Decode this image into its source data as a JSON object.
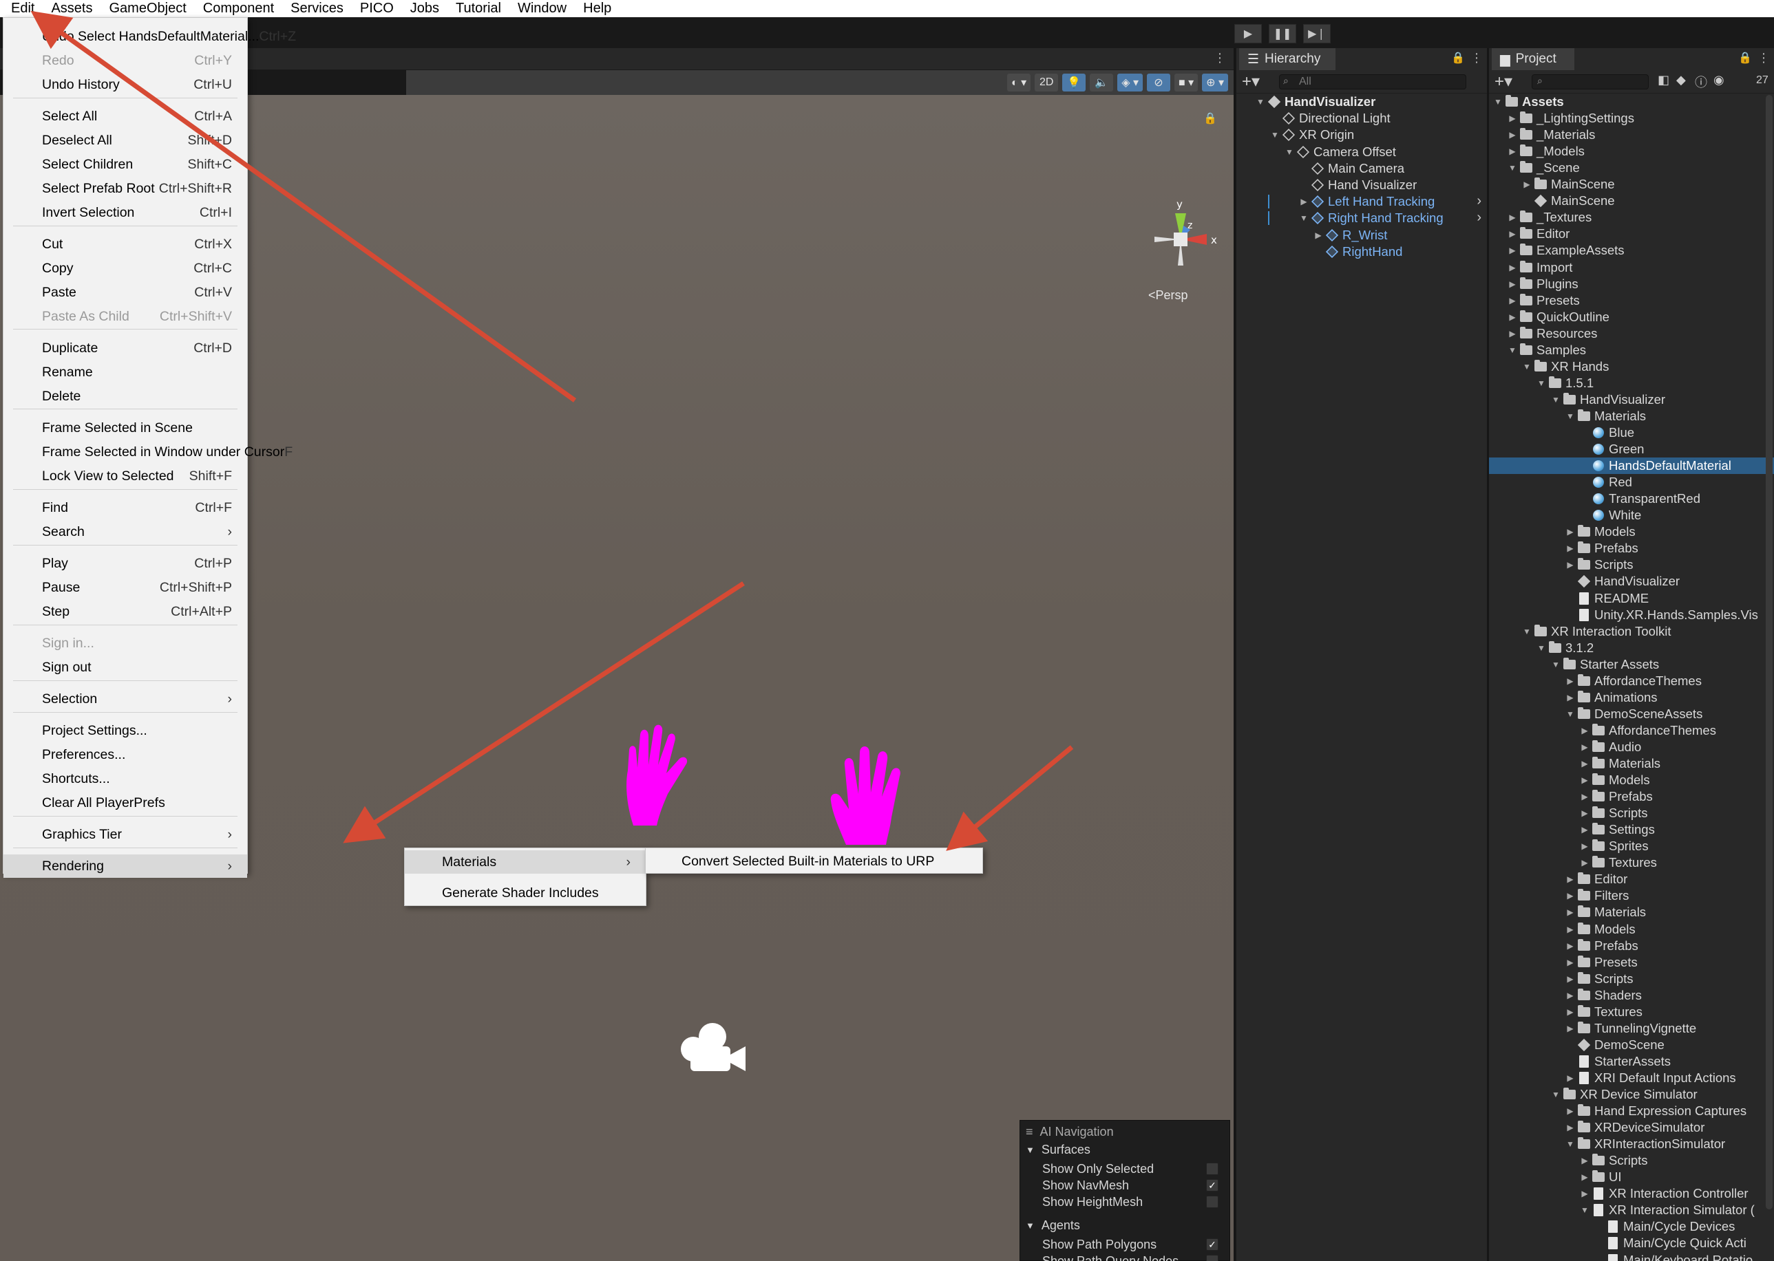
{
  "menubar": [
    "Edit",
    "Assets",
    "GameObject",
    "Component",
    "Services",
    "PICO",
    "Jobs",
    "Tutorial",
    "Window",
    "Help"
  ],
  "edit_menu": {
    "items": [
      {
        "label": "Undo Select HandsDefaultMaterial...",
        "shortcut": "Ctrl+Z"
      },
      {
        "label": "Redo",
        "shortcut": "Ctrl+Y",
        "disabled": true
      },
      {
        "label": "Undo History",
        "shortcut": "Ctrl+U"
      },
      {
        "label": "Select All",
        "shortcut": "Ctrl+A"
      },
      {
        "label": "Deselect All",
        "shortcut": "Shift+D"
      },
      {
        "label": "Select Children",
        "shortcut": "Shift+C"
      },
      {
        "label": "Select Prefab Root",
        "shortcut": "Ctrl+Shift+R"
      },
      {
        "label": "Invert Selection",
        "shortcut": "Ctrl+I"
      },
      {
        "label": "Cut",
        "shortcut": "Ctrl+X"
      },
      {
        "label": "Copy",
        "shortcut": "Ctrl+C"
      },
      {
        "label": "Paste",
        "shortcut": "Ctrl+V"
      },
      {
        "label": "Paste As Child",
        "shortcut": "Ctrl+Shift+V",
        "disabled": true
      },
      {
        "label": "Duplicate",
        "shortcut": "Ctrl+D"
      },
      {
        "label": "Rename",
        "shortcut": ""
      },
      {
        "label": "Delete",
        "shortcut": ""
      },
      {
        "label": "Frame Selected in Scene",
        "shortcut": ""
      },
      {
        "label": "Frame Selected in Window under Cursor",
        "shortcut": "F"
      },
      {
        "label": "Lock View to Selected",
        "shortcut": "Shift+F"
      },
      {
        "label": "Find",
        "shortcut": "Ctrl+F"
      },
      {
        "label": "Search",
        "shortcut": "›"
      },
      {
        "label": "Play",
        "shortcut": "Ctrl+P"
      },
      {
        "label": "Pause",
        "shortcut": "Ctrl+Shift+P"
      },
      {
        "label": "Step",
        "shortcut": "Ctrl+Alt+P"
      },
      {
        "label": "Sign in...",
        "shortcut": "",
        "disabled": true
      },
      {
        "label": "Sign out",
        "shortcut": ""
      },
      {
        "label": "Selection",
        "shortcut": "›"
      },
      {
        "label": "Project Settings...",
        "shortcut": ""
      },
      {
        "label": "Preferences...",
        "shortcut": ""
      },
      {
        "label": "Shortcuts...",
        "shortcut": ""
      },
      {
        "label": "Clear All PlayerPrefs",
        "shortcut": ""
      },
      {
        "label": "Graphics Tier",
        "shortcut": "›"
      },
      {
        "label": "Rendering",
        "shortcut": "›",
        "highlighted": true
      }
    ]
  },
  "submenu_rendering": [
    {
      "label": "Materials",
      "shortcut": "›",
      "highlighted": true
    },
    {
      "label": "Generate Shader Includes",
      "shortcut": ""
    }
  ],
  "submenu_materials": [
    {
      "label": "Convert Selected Built-in Materials to URP"
    }
  ],
  "scene": {
    "toolbar_2d": "2D",
    "persp_label": "<Persp",
    "gizmo_axes": {
      "y": "y",
      "z": "z",
      "x": "x"
    }
  },
  "hierarchy": {
    "tab": "Hierarchy",
    "search_placeholder": "All",
    "rows": [
      {
        "label": "HandVisualizer",
        "depth": 0,
        "bold": true,
        "icon": "unity-scene-icon",
        "arrow": "▼"
      },
      {
        "label": "Directional Light",
        "depth": 1,
        "icon": "gameobject-icon",
        "arrow": ""
      },
      {
        "label": "XR Origin",
        "depth": 1,
        "icon": "gameobject-icon",
        "arrow": "▼"
      },
      {
        "label": "Camera Offset",
        "depth": 2,
        "icon": "gameobject-icon",
        "arrow": "▼"
      },
      {
        "label": "Main Camera",
        "depth": 3,
        "icon": "gameobject-icon",
        "arrow": ""
      },
      {
        "label": "Hand Visualizer",
        "depth": 3,
        "icon": "gameobject-icon",
        "arrow": ""
      },
      {
        "label": "Left Hand Tracking",
        "depth": 3,
        "icon": "prefab-icon",
        "arrow": "▶",
        "prefab": true
      },
      {
        "label": "Right Hand Tracking",
        "depth": 3,
        "icon": "prefab-icon",
        "arrow": "▼",
        "prefab": true
      },
      {
        "label": "R_Wrist",
        "depth": 4,
        "icon": "gameobject-icon",
        "arrow": "▶",
        "prefab": true
      },
      {
        "label": "RightHand",
        "depth": 4,
        "icon": "gameobject-icon",
        "arrow": "",
        "prefab": true
      }
    ]
  },
  "project": {
    "tab": "Project",
    "count": "27",
    "rows": [
      {
        "label": "Assets",
        "depth": 0,
        "arrow": "▼",
        "icon": "folder",
        "bold": true
      },
      {
        "label": "_LightingSettings",
        "depth": 1,
        "arrow": "▶",
        "icon": "folder"
      },
      {
        "label": "_Materials",
        "depth": 1,
        "arrow": "▶",
        "icon": "folder"
      },
      {
        "label": "_Models",
        "depth": 1,
        "arrow": "▶",
        "icon": "folder"
      },
      {
        "label": "_Scene",
        "depth": 1,
        "arrow": "▼",
        "icon": "folder"
      },
      {
        "label": "MainScene",
        "depth": 2,
        "arrow": "▶",
        "icon": "folder"
      },
      {
        "label": "MainScene",
        "depth": 2,
        "arrow": "",
        "icon": "scene"
      },
      {
        "label": "_Textures",
        "depth": 1,
        "arrow": "▶",
        "icon": "folder"
      },
      {
        "label": "Editor",
        "depth": 1,
        "arrow": "▶",
        "icon": "folder"
      },
      {
        "label": "ExampleAssets",
        "depth": 1,
        "arrow": "▶",
        "icon": "folder"
      },
      {
        "label": "Import",
        "depth": 1,
        "arrow": "▶",
        "icon": "folder"
      },
      {
        "label": "Plugins",
        "depth": 1,
        "arrow": "▶",
        "icon": "folder"
      },
      {
        "label": "Presets",
        "depth": 1,
        "arrow": "▶",
        "icon": "folder"
      },
      {
        "label": "QuickOutline",
        "depth": 1,
        "arrow": "▶",
        "icon": "folder"
      },
      {
        "label": "Resources",
        "depth": 1,
        "arrow": "▶",
        "icon": "folder"
      },
      {
        "label": "Samples",
        "depth": 1,
        "arrow": "▼",
        "icon": "folder"
      },
      {
        "label": "XR Hands",
        "depth": 2,
        "arrow": "▼",
        "icon": "folder"
      },
      {
        "label": "1.5.1",
        "depth": 3,
        "arrow": "▼",
        "icon": "folder"
      },
      {
        "label": "HandVisualizer",
        "depth": 4,
        "arrow": "▼",
        "icon": "folder"
      },
      {
        "label": "Materials",
        "depth": 5,
        "arrow": "▼",
        "icon": "folder"
      },
      {
        "label": "Blue",
        "depth": 6,
        "arrow": "",
        "icon": "material"
      },
      {
        "label": "Green",
        "depth": 6,
        "arrow": "",
        "icon": "material"
      },
      {
        "label": "HandsDefaultMaterial",
        "depth": 6,
        "arrow": "",
        "icon": "material",
        "selected": true
      },
      {
        "label": "Red",
        "depth": 6,
        "arrow": "",
        "icon": "material"
      },
      {
        "label": "TransparentRed",
        "depth": 6,
        "arrow": "",
        "icon": "material"
      },
      {
        "label": "White",
        "depth": 6,
        "arrow": "",
        "icon": "material"
      },
      {
        "label": "Models",
        "depth": 5,
        "arrow": "▶",
        "icon": "folder"
      },
      {
        "label": "Prefabs",
        "depth": 5,
        "arrow": "▶",
        "icon": "folder"
      },
      {
        "label": "Scripts",
        "depth": 5,
        "arrow": "▶",
        "icon": "folder"
      },
      {
        "label": "HandVisualizer",
        "depth": 5,
        "arrow": "",
        "icon": "scene"
      },
      {
        "label": "README",
        "depth": 5,
        "arrow": "",
        "icon": "doc"
      },
      {
        "label": "Unity.XR.Hands.Samples.Vis",
        "depth": 5,
        "arrow": "",
        "icon": "doc"
      },
      {
        "label": "XR Interaction Toolkit",
        "depth": 2,
        "arrow": "▼",
        "icon": "folder"
      },
      {
        "label": "3.1.2",
        "depth": 3,
        "arrow": "▼",
        "icon": "folder"
      },
      {
        "label": "Starter Assets",
        "depth": 4,
        "arrow": "▼",
        "icon": "folder"
      },
      {
        "label": "AffordanceThemes",
        "depth": 5,
        "arrow": "▶",
        "icon": "folder"
      },
      {
        "label": "Animations",
        "depth": 5,
        "arrow": "▶",
        "icon": "folder"
      },
      {
        "label": "DemoSceneAssets",
        "depth": 5,
        "arrow": "▼",
        "icon": "folder"
      },
      {
        "label": "AffordanceThemes",
        "depth": 6,
        "arrow": "▶",
        "icon": "folder"
      },
      {
        "label": "Audio",
        "depth": 6,
        "arrow": "▶",
        "icon": "folder"
      },
      {
        "label": "Materials",
        "depth": 6,
        "arrow": "▶",
        "icon": "folder"
      },
      {
        "label": "Models",
        "depth": 6,
        "arrow": "▶",
        "icon": "folder"
      },
      {
        "label": "Prefabs",
        "depth": 6,
        "arrow": "▶",
        "icon": "folder"
      },
      {
        "label": "Scripts",
        "depth": 6,
        "arrow": "▶",
        "icon": "folder"
      },
      {
        "label": "Settings",
        "depth": 6,
        "arrow": "▶",
        "icon": "folder"
      },
      {
        "label": "Sprites",
        "depth": 6,
        "arrow": "▶",
        "icon": "folder"
      },
      {
        "label": "Textures",
        "depth": 6,
        "arrow": "▶",
        "icon": "folder"
      },
      {
        "label": "Editor",
        "depth": 5,
        "arrow": "▶",
        "icon": "folder"
      },
      {
        "label": "Filters",
        "depth": 5,
        "arrow": "▶",
        "icon": "folder"
      },
      {
        "label": "Materials",
        "depth": 5,
        "arrow": "▶",
        "icon": "folder"
      },
      {
        "label": "Models",
        "depth": 5,
        "arrow": "▶",
        "icon": "folder"
      },
      {
        "label": "Prefabs",
        "depth": 5,
        "arrow": "▶",
        "icon": "folder"
      },
      {
        "label": "Presets",
        "depth": 5,
        "arrow": "▶",
        "icon": "folder"
      },
      {
        "label": "Scripts",
        "depth": 5,
        "arrow": "▶",
        "icon": "folder"
      },
      {
        "label": "Shaders",
        "depth": 5,
        "arrow": "▶",
        "icon": "folder"
      },
      {
        "label": "Textures",
        "depth": 5,
        "arrow": "▶",
        "icon": "folder"
      },
      {
        "label": "TunnelingVignette",
        "depth": 5,
        "arrow": "▶",
        "icon": "folder"
      },
      {
        "label": "DemoScene",
        "depth": 5,
        "arrow": "",
        "icon": "scene"
      },
      {
        "label": "StarterAssets",
        "depth": 5,
        "arrow": "",
        "icon": "doc"
      },
      {
        "label": "XRI Default Input Actions",
        "depth": 5,
        "arrow": "▶",
        "icon": "doc"
      },
      {
        "label": "XR Device Simulator",
        "depth": 4,
        "arrow": "▼",
        "icon": "folder"
      },
      {
        "label": "Hand Expression Captures",
        "depth": 5,
        "arrow": "▶",
        "icon": "folder"
      },
      {
        "label": "XRDeviceSimulator",
        "depth": 5,
        "arrow": "▶",
        "icon": "folder"
      },
      {
        "label": "XRInteractionSimulator",
        "depth": 5,
        "arrow": "▼",
        "icon": "folder"
      },
      {
        "label": "Scripts",
        "depth": 6,
        "arrow": "▶",
        "icon": "folder"
      },
      {
        "label": "UI",
        "depth": 6,
        "arrow": "▶",
        "icon": "folder"
      },
      {
        "label": "XR Interaction Controller",
        "depth": 6,
        "arrow": "▶",
        "icon": "doc"
      },
      {
        "label": "XR Interaction Simulator (",
        "depth": 6,
        "arrow": "▼",
        "icon": "doc"
      },
      {
        "label": "Main/Cycle Devices",
        "depth": 7,
        "arrow": "",
        "icon": "doc"
      },
      {
        "label": "Main/Cycle Quick Acti",
        "depth": 7,
        "arrow": "",
        "icon": "doc"
      },
      {
        "label": "Main/Keyboard Rotatio",
        "depth": 7,
        "arrow": "",
        "icon": "doc"
      }
    ]
  },
  "ai_navigation": {
    "title": "AI Navigation",
    "surfaces": "Surfaces",
    "options": [
      {
        "label": "Show Only Selected",
        "checked": false
      },
      {
        "label": "Show NavMesh",
        "checked": true
      },
      {
        "label": "Show HeightMesh",
        "checked": false
      }
    ],
    "agents": "Agents",
    "agent_options": [
      {
        "label": "Show Path Polygons",
        "checked": true
      },
      {
        "label": "Show Path Query Nodes",
        "checked": false
      }
    ]
  },
  "colors": {
    "accent_arrow": "#d64a34",
    "selection": "#2c5d87",
    "hand": "#ff00ff"
  }
}
